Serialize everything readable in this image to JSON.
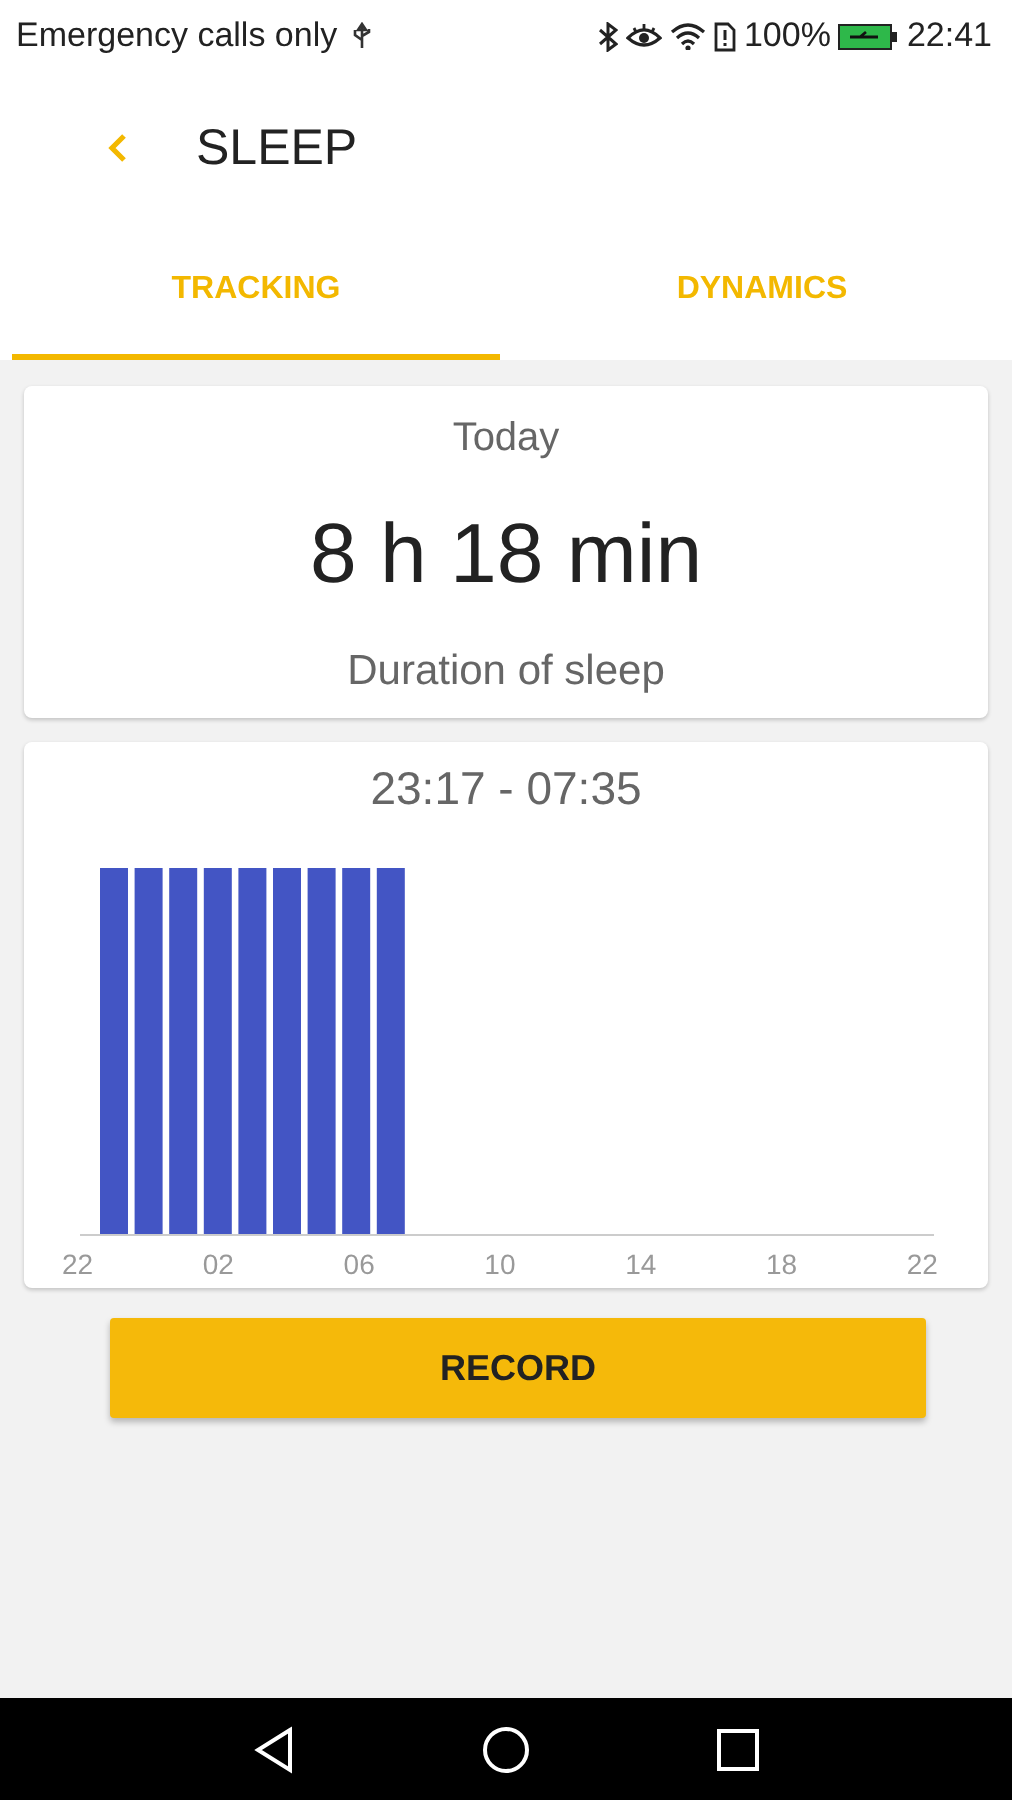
{
  "status_bar": {
    "carrier": "Emergency calls only",
    "battery": "100%",
    "time": "22:41"
  },
  "header": {
    "title": "SLEEP"
  },
  "tabs": [
    {
      "label": "TRACKING",
      "selected": true
    },
    {
      "label": "DYNAMICS",
      "selected": false
    }
  ],
  "summary": {
    "day": "Today",
    "duration": "8 h 18 min",
    "caption": "Duration of sleep"
  },
  "timeline": {
    "range": "23:17 - 07:35",
    "axis_labels": [
      "22",
      "02",
      "06",
      "10",
      "14",
      "18",
      "22"
    ]
  },
  "button": "RECORD"
}
